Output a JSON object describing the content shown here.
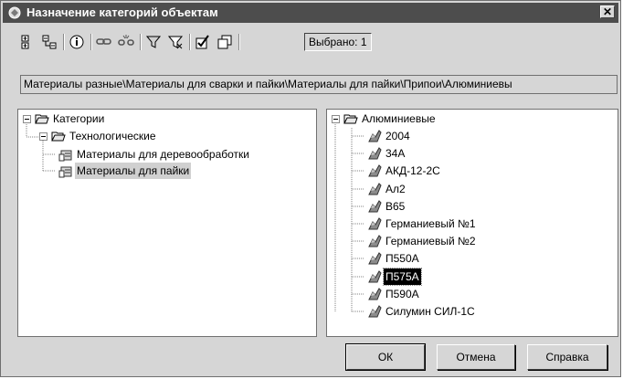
{
  "window": {
    "title": "Назначение категорий объектам",
    "close_label": "✕"
  },
  "toolbar": {
    "icons": [
      "expand-all-icon",
      "collapse-all-icon",
      "info-icon",
      "link-icon",
      "unlink-icon",
      "filter-icon",
      "filter-clear-icon",
      "check-all-icon",
      "uncheck-all-icon"
    ],
    "selected_label": "Выбрано: 1"
  },
  "path": {
    "text": "Материалы разные\\Материалы для сварки и пайки\\Материалы для пайки\\Припои\\Алюминиевы"
  },
  "left_tree": {
    "root": "Категории",
    "group": "Технологические",
    "items": [
      "Материалы для деревообработки",
      "Материалы для пайки"
    ]
  },
  "right_tree": {
    "root": "Алюминиевые",
    "items": [
      "2004",
      "34А",
      "АКД-12-2С",
      "Ал2",
      "В65",
      "Германиевый №1",
      "Германиевый №2",
      "П550А",
      "П575А",
      "П590А",
      "Силумин СИЛ-1С"
    ]
  },
  "buttons": {
    "ok": "ОК",
    "cancel": "Отмена",
    "help": "Справка"
  }
}
